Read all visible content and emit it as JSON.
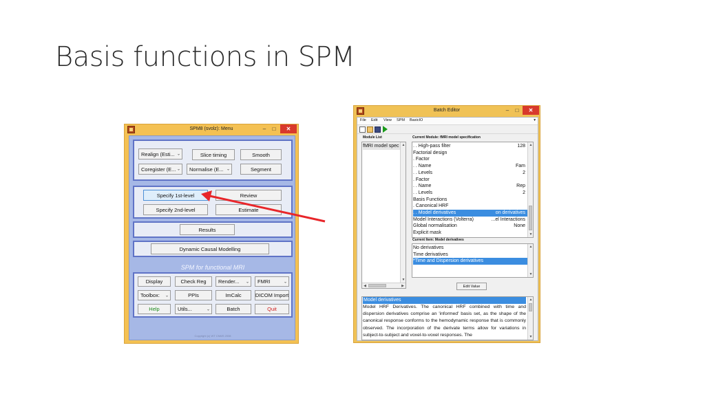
{
  "slide": {
    "title": "Basis functions in SPM"
  },
  "spm_menu": {
    "window_title": "SPM8 (svolz): Menu",
    "controls": {
      "minimize": "–",
      "maximize": "□",
      "close": "✕"
    },
    "spatial": {
      "realign": "Realign (Esti...",
      "slice_timing": "Slice timing",
      "smooth": "Smooth",
      "coregister": "Coregister (E...",
      "normalise": "Normalise (E...",
      "segment": "Segment"
    },
    "model": {
      "specify_first": "Specify 1st-level",
      "review": "Review",
      "specify_second": "Specify 2nd-level",
      "estimate": "Estimate"
    },
    "inference": {
      "results": "Results"
    },
    "dcm": {
      "label": "Dynamic Causal Modelling"
    },
    "footer_label": "SPM for functional MRI",
    "tools": {
      "display": "Display",
      "check_reg": "Check Reg",
      "render": "Render...",
      "fmri": "FMRI",
      "toolbox": "Toolbox:",
      "ppis": "PPIs",
      "imcalc": "ImCalc",
      "dicom": "DICOM Import",
      "help": "Help",
      "utils": "Utils...",
      "batch": "Batch",
      "quit": "Quit"
    },
    "copyright": "Copyright (c) WT CNMS 2008",
    "colors": {
      "frame": "#f4c153",
      "panel_bg": "#a6b8e6",
      "panel_border": "#5f73c6",
      "help": "#1c8a1c",
      "quit": "#d02020"
    }
  },
  "batch_editor": {
    "window_title": "Batch Editor",
    "menu": {
      "file": "File",
      "edit": "Edit",
      "view": "View",
      "spm": "SPM",
      "basicio": "BasicIO",
      "more": "▾"
    },
    "toolbar_icons": [
      "new-file-icon",
      "open-folder-icon",
      "save-icon",
      "run-icon"
    ],
    "module_list_label": "Module List",
    "module_list_items": [
      "fMRI model spec"
    ],
    "current_module_label": "Current Module: fMRI model specification",
    "current_module_rows": [
      {
        "label": ". . High-pass filter",
        "value": "128"
      },
      {
        "label": "Factorial design",
        "value": ""
      },
      {
        "label": ". Factor",
        "value": ""
      },
      {
        "label": ". . Name",
        "value": "Fam"
      },
      {
        "label": ". . Levels",
        "value": "2"
      },
      {
        "label": ". Factor",
        "value": ""
      },
      {
        "label": ". . Name",
        "value": "Rep"
      },
      {
        "label": ". . Levels",
        "value": "2"
      },
      {
        "label": "Basis Functions",
        "value": ""
      },
      {
        "label": ". Canonical HRF",
        "value": ""
      },
      {
        "label": ". . Model derivatives",
        "value": "on derivatives"
      },
      {
        "label": "Model Interactions (Volterra)",
        "value": "...el Interactions"
      },
      {
        "label": "Global normalisation",
        "value": "None"
      },
      {
        "label": "Explicit mask",
        "value": ""
      }
    ],
    "current_item_label": "Current Item: Model derivatives",
    "current_item_options": [
      "No derivatives",
      "Time derivatives",
      "*Time and Dispersion derivatives"
    ],
    "edit_value_button": "Edit Value",
    "help_title": "Model derivatives",
    "help_text": "Model HRF Derivatives. The canonical HRF combined with time and dispersion derivatives comprise an 'informed' basis set, as the shape of the canonical response conforms to the hemodynamic response that is commonly observed. The incorporation of the derivate terms allow for variations in subject-to-subject and voxel-to-voxel responses. The",
    "colors": {
      "highlight": "#3b8de0",
      "frame": "#f0c256"
    }
  },
  "annotation": {
    "arrow_color": "#e8262a"
  }
}
